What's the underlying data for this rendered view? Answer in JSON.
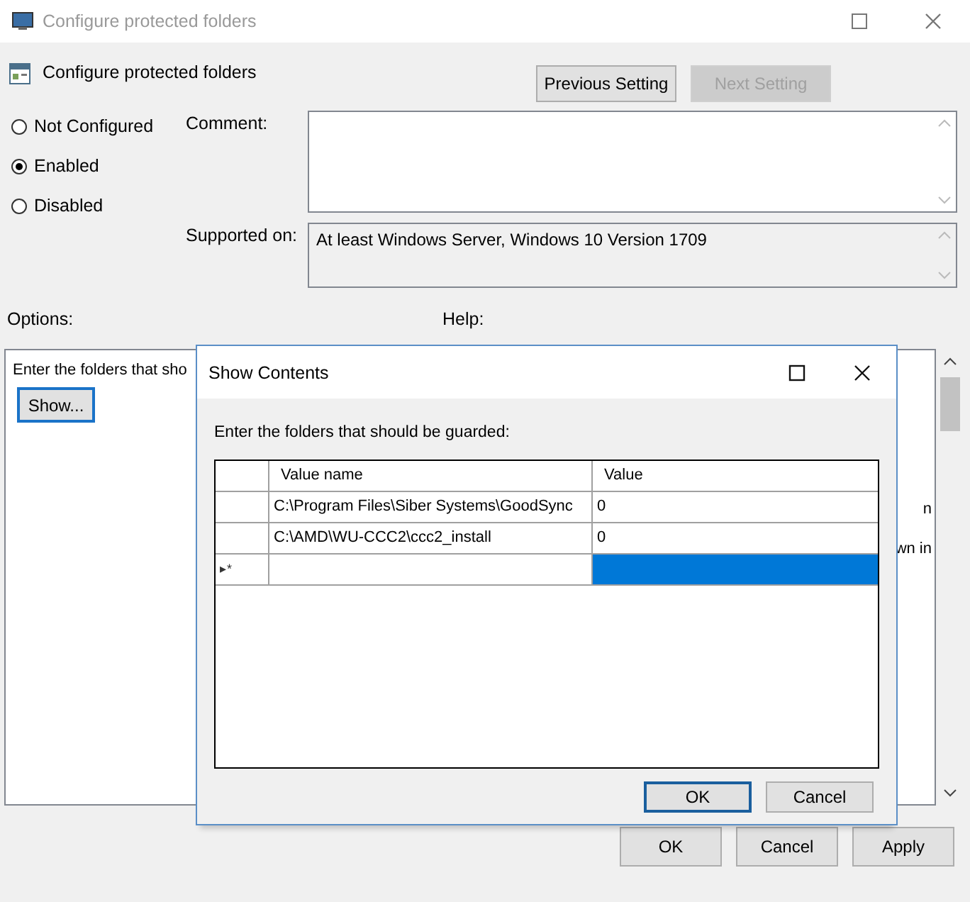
{
  "window": {
    "title": "Configure protected folders"
  },
  "policy": {
    "name": "Configure protected folders"
  },
  "nav_buttons": [
    {
      "label": "Previous Setting",
      "disabled": false
    },
    {
      "label": "Next Setting",
      "disabled": true
    }
  ],
  "state_options": [
    {
      "label": "Not Configured",
      "selected": false
    },
    {
      "label": "Enabled",
      "selected": true
    },
    {
      "label": "Disabled",
      "selected": false
    }
  ],
  "comment": {
    "label": "Comment:"
  },
  "supported_on": {
    "label": "Supported on:",
    "value": "At least Windows Server, Windows 10 Version 1709"
  },
  "options": {
    "label": "Options:",
    "text": "Enter the folders that sho",
    "button": "Show..."
  },
  "help": {
    "label": "Help:",
    "fragments": [
      "n",
      "wn in"
    ]
  },
  "buttons": [
    "OK",
    "Cancel",
    "Apply"
  ],
  "dialog": {
    "title": "Show Contents",
    "prompt": "Enter the folders that should be guarded:",
    "columns": [
      "Value name",
      "Value"
    ],
    "rows": [
      {
        "kind": "entry",
        "name": "C:\\Program Files\\Siber Systems\\GoodSync",
        "value": "0",
        "selected": false
      },
      {
        "kind": "entry",
        "name": "C:\\AMD\\WU-CCC2\\ccc2_install",
        "value": "0",
        "selected": false
      },
      {
        "kind": "new",
        "marker": "▸*",
        "selected": true
      }
    ],
    "buttons": [
      {
        "label": "OK",
        "default": true
      },
      {
        "label": "Cancel",
        "default": false
      }
    ]
  }
}
